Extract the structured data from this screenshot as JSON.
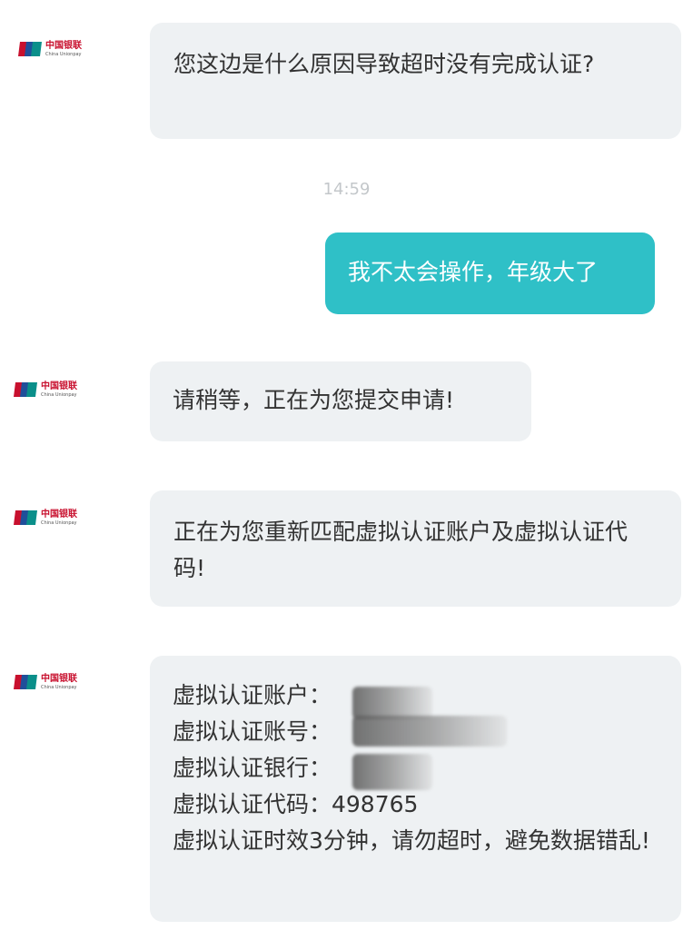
{
  "brand": {
    "name_cn": "中国银联",
    "name_en": "China Unionpay"
  },
  "messages": [
    {
      "id": "m1",
      "direction": "incoming",
      "text": "您这边是什么原因导致超时没有完成认证?"
    },
    {
      "id": "ts",
      "type": "timestamp",
      "text": "14:59"
    },
    {
      "id": "m2",
      "direction": "outgoing",
      "text": "我不太会操作，年级大了"
    },
    {
      "id": "m3",
      "direction": "incoming",
      "text": "请稍等，正在为您提交申请!"
    },
    {
      "id": "m4",
      "direction": "incoming",
      "text": "正在为您重新匹配虚拟认证账户及虚拟认证代码!"
    },
    {
      "id": "m5",
      "direction": "incoming",
      "lines": [
        "虚拟认证账户：",
        "虚拟认证账号：",
        "虚拟认证银行：",
        "虚拟认证代码：498765",
        "虚拟认证时效3分钟，请勿超时，避免数据错乱!"
      ]
    }
  ],
  "colors": {
    "incoming_bubble": "#eef1f3",
    "outgoing_bubble": "#2fc0c7",
    "brand_red": "#c8102e",
    "brand_blue": "#1f4f9a",
    "brand_teal": "#0a8f8a"
  },
  "icons": [
    "unionpay-logo-icon"
  ]
}
